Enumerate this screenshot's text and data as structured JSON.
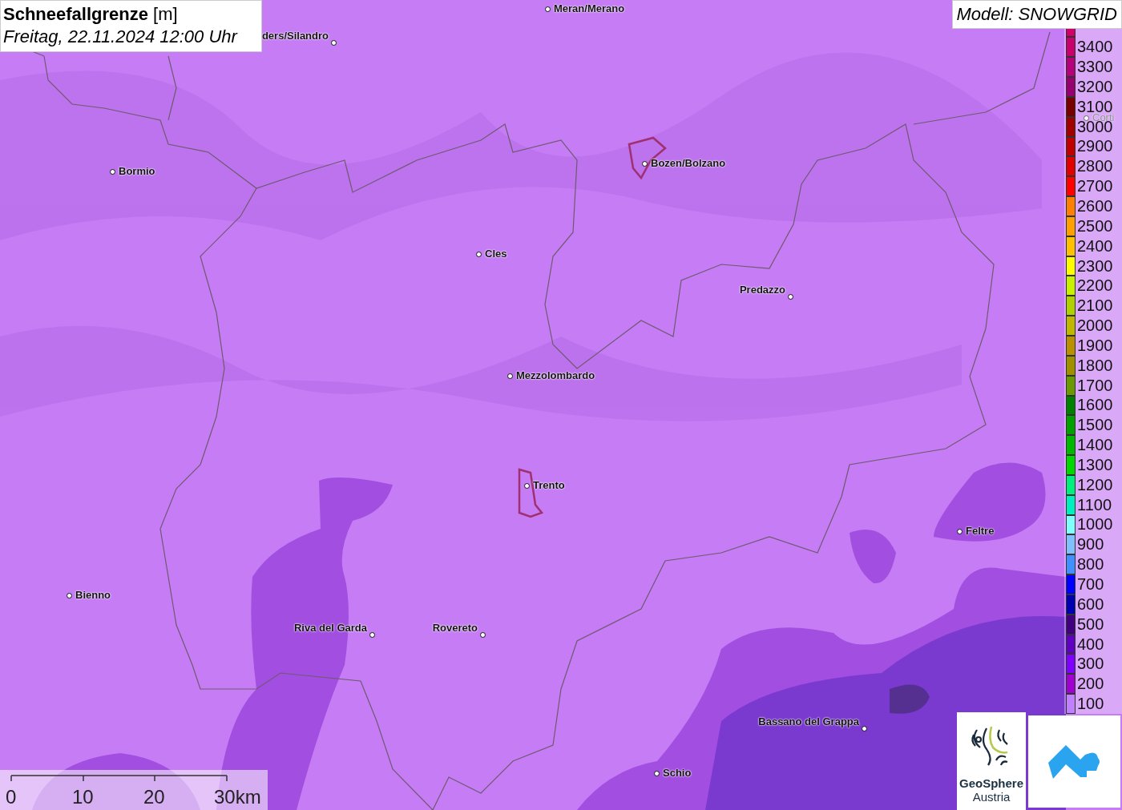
{
  "title": {
    "heading": "Schneefallgrenze",
    "unit": "[m]",
    "datetime": "Freitag, 22.11.2024 12:00 Uhr"
  },
  "model": "Modell: SNOWGRID",
  "places": [
    {
      "name": "Meran/Merano"
    },
    {
      "name": "ders/Silandro"
    },
    {
      "name": "Bormio"
    },
    {
      "name": "Bozen/Bolzano"
    },
    {
      "name": "Cles"
    },
    {
      "name": "Predazzo"
    },
    {
      "name": "Mezzolombardo"
    },
    {
      "name": "Trento"
    },
    {
      "name": "Feltre"
    },
    {
      "name": "Bienno"
    },
    {
      "name": "Riva del Garda"
    },
    {
      "name": "Rovereto"
    },
    {
      "name": "Bassano del Grappa"
    },
    {
      "name": "Schio"
    },
    {
      "name": "Corti"
    }
  ],
  "legend": [
    {
      "label": "3400",
      "color": "#c8006e"
    },
    {
      "label": "3300",
      "color": "#b4007a"
    },
    {
      "label": "3200",
      "color": "#960070"
    },
    {
      "label": "3100",
      "color": "#780000"
    },
    {
      "label": "3000",
      "color": "#a00000"
    },
    {
      "label": "2900",
      "color": "#c00000"
    },
    {
      "label": "2800",
      "color": "#e00000"
    },
    {
      "label": "2700",
      "color": "#ff0000"
    },
    {
      "label": "2600",
      "color": "#ff8000"
    },
    {
      "label": "2500",
      "color": "#ffa000"
    },
    {
      "label": "2400",
      "color": "#ffc000"
    },
    {
      "label": "2300",
      "color": "#ffff00"
    },
    {
      "label": "2200",
      "color": "#c8f000"
    },
    {
      "label": "2100",
      "color": "#b0d000"
    },
    {
      "label": "2000",
      "color": "#c0b800"
    },
    {
      "label": "1900",
      "color": "#b89000"
    },
    {
      "label": "1800",
      "color": "#a09000"
    },
    {
      "label": "1700",
      "color": "#6a9a00"
    },
    {
      "label": "1600",
      "color": "#008000"
    },
    {
      "label": "1500",
      "color": "#00a000"
    },
    {
      "label": "1400",
      "color": "#00b800"
    },
    {
      "label": "1300",
      "color": "#00d800"
    },
    {
      "label": "1200",
      "color": "#00f080"
    },
    {
      "label": "1100",
      "color": "#00f0c0"
    },
    {
      "label": "1000",
      "color": "#80ffff"
    },
    {
      "label": "900",
      "color": "#80c0ff"
    },
    {
      "label": "800",
      "color": "#4090ff"
    },
    {
      "label": "700",
      "color": "#0000ff"
    },
    {
      "label": "600",
      "color": "#0000b0"
    },
    {
      "label": "500",
      "color": "#400080"
    },
    {
      "label": "400",
      "color": "#6000c0"
    },
    {
      "label": "300",
      "color": "#8000ff"
    },
    {
      "label": "200",
      "color": "#a000d0"
    },
    {
      "label": "100",
      "color": "#c080ff"
    }
  ],
  "scale": [
    "0",
    "10",
    "20",
    "30km"
  ],
  "logo": {
    "line1": "GeoSphere",
    "line2": "Austria"
  }
}
